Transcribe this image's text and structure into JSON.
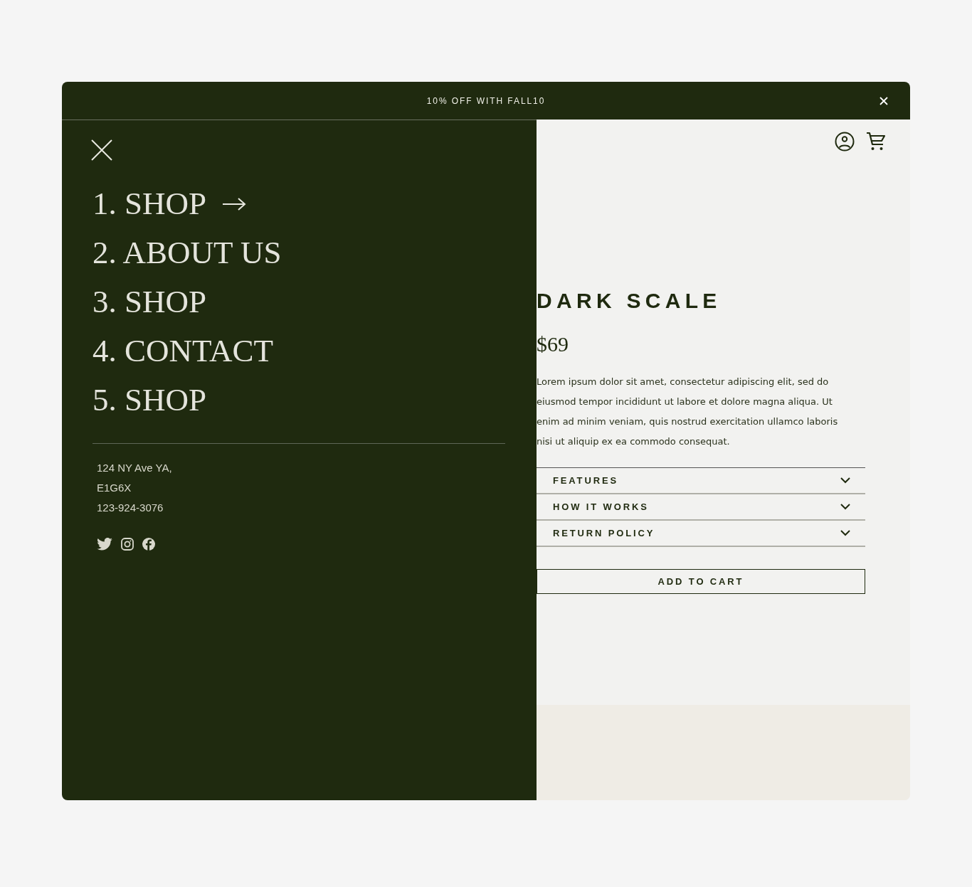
{
  "banner": {
    "text": "10% OFF WITH FALL10"
  },
  "menu": {
    "items": [
      {
        "label": "1. SHOP",
        "arrow": true
      },
      {
        "label": "2. ABOUT US",
        "arrow": false
      },
      {
        "label": "3. SHOP",
        "arrow": false
      },
      {
        "label": "4. CONTACT",
        "arrow": false
      },
      {
        "label": "5. SHOP",
        "arrow": false
      }
    ],
    "contact": [
      "124 NY Ave YA,",
      "E1G6X",
      "123-924-3076"
    ],
    "social": [
      {
        "kind": "twitter"
      },
      {
        "kind": "instagram"
      },
      {
        "kind": "facebook"
      }
    ]
  },
  "product": {
    "title": "DARK SCALE",
    "price": "$69",
    "description": "Lorem ipsum dolor sit amet, consectetur adipiscing elit, sed do eiusmod tempor incididunt ut labore et dolore magna aliqua. Ut enim ad minim veniam, quis nostrud exercitation ullamco laboris nisi ut aliquip ex ea commodo consequat.",
    "accordion": [
      {
        "label": "FEATURES",
        "expanded": false
      },
      {
        "label": "HOW IT WORKS",
        "expanded": false
      },
      {
        "label": "RETURN POLICY",
        "expanded": false
      }
    ],
    "button": "ADD TO CART"
  }
}
